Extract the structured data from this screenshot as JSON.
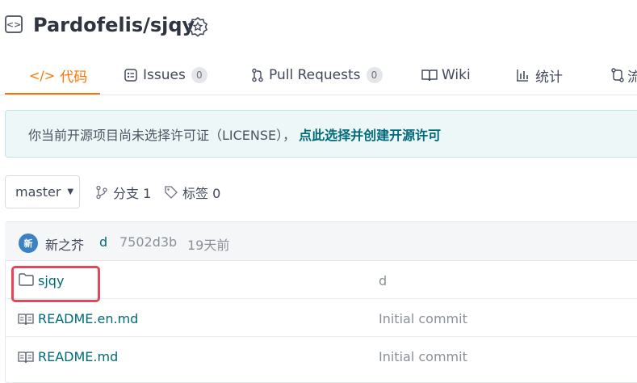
{
  "header": {
    "repo_title": "Pardofelis/sjqy",
    "repo_icon": "code-repo-icon",
    "badge_icon": "award-badge-icon"
  },
  "tabs": [
    {
      "label": "代码",
      "icon": "code-icon",
      "active": true
    },
    {
      "label": "Issues",
      "icon": "issues-icon",
      "count": "0"
    },
    {
      "label": "Pull Requests",
      "icon": "pull-request-icon",
      "count": "0"
    },
    {
      "label": "Wiki",
      "icon": "wiki-icon"
    },
    {
      "label": "统计",
      "icon": "stats-icon"
    },
    {
      "label": "流",
      "icon": "pipeline-icon"
    }
  ],
  "notice": {
    "text": "你当前开源项目尚未选择许可证（LICENSE），",
    "link": "点此选择并创建开源许可"
  },
  "branch": {
    "selected": "master",
    "branches_label": "分支 1",
    "tags_label": "标签 0"
  },
  "latest_commit": {
    "avatar_text": "新",
    "author": "新之芥",
    "message": "d",
    "hash": "7502d3b",
    "time": "19天前"
  },
  "files": [
    {
      "name": "sjqy",
      "type": "folder",
      "commit": "d"
    },
    {
      "name": "README.en.md",
      "type": "readme",
      "commit": "Initial commit"
    },
    {
      "name": "README.md",
      "type": "readme",
      "commit": "Initial commit"
    }
  ],
  "colors": {
    "accent": "#fe7300",
    "link": "#006a79",
    "highlight": "#e8445a"
  }
}
